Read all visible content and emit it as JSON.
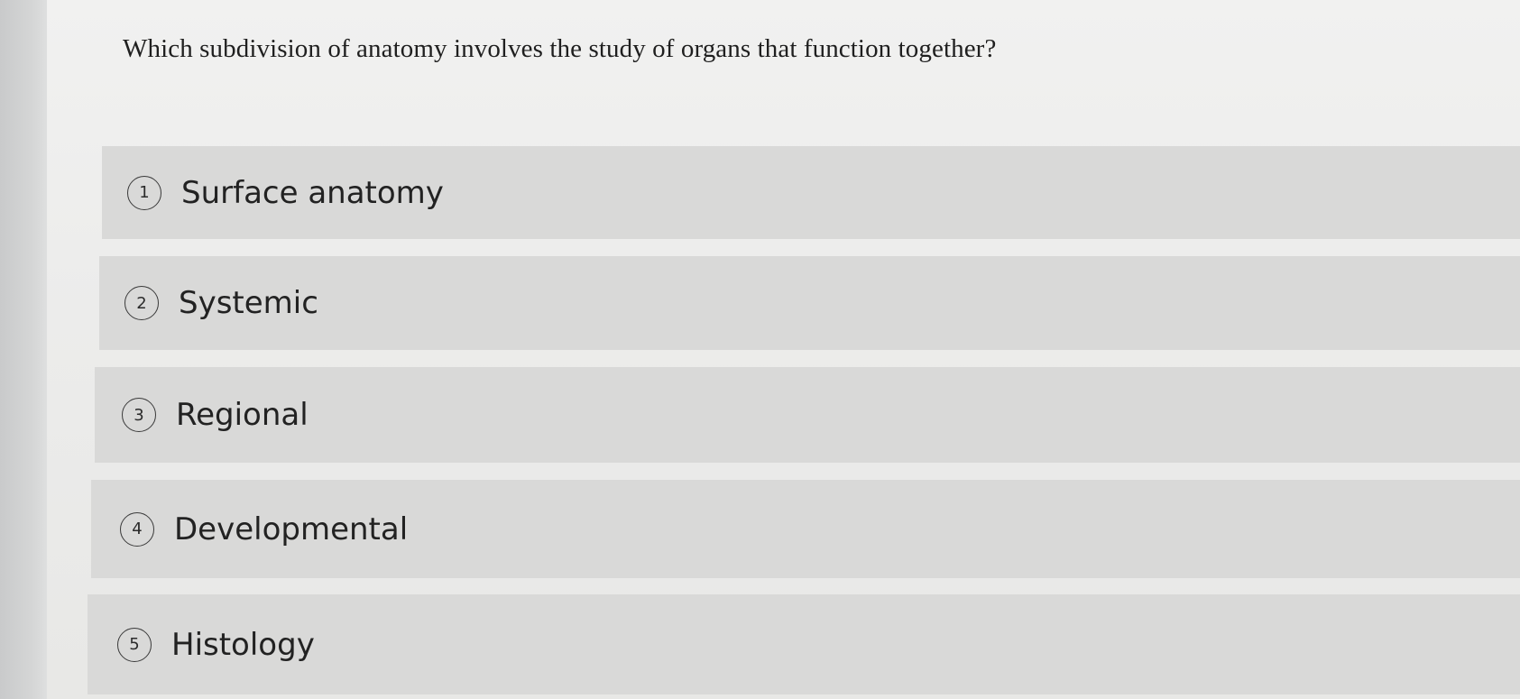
{
  "question": {
    "text": "Which subdivision of anatomy involves the study of organs that function together?"
  },
  "options": [
    {
      "number": "1",
      "label": "Surface anatomy"
    },
    {
      "number": "2",
      "label": "Systemic"
    },
    {
      "number": "3",
      "label": "Regional"
    },
    {
      "number": "4",
      "label": "Developmental"
    },
    {
      "number": "5",
      "label": "Histology"
    }
  ]
}
